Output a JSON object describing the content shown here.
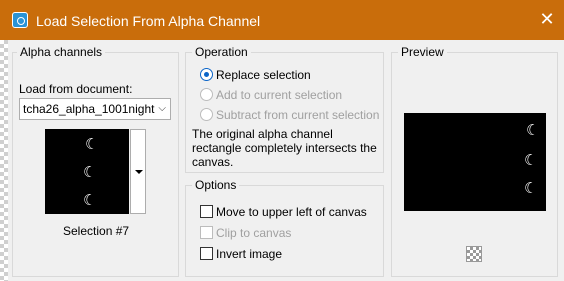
{
  "window": {
    "title": "Load Selection From Alpha Channel",
    "close_glyph": "✕",
    "accent": "#c96d0b",
    "app_icon": "camera-icon"
  },
  "alpha_channels": {
    "group_label": "Alpha channels",
    "load_from_label": "Load from document:",
    "document_value": "tcha26_alpha_1001night",
    "selection_caption": "Selection #7"
  },
  "operation": {
    "group_label": "Operation",
    "options": [
      {
        "label": "Replace selection",
        "checked": true,
        "enabled": true
      },
      {
        "label": "Add to current selection",
        "checked": false,
        "enabled": false
      },
      {
        "label": "Subtract from current selection",
        "checked": false,
        "enabled": false
      }
    ],
    "description": "The original alpha channel rectangle completely intersects the canvas."
  },
  "options": {
    "group_label": "Options",
    "items": [
      {
        "label": "Move to upper left of canvas",
        "checked": false,
        "enabled": true
      },
      {
        "label": "Clip to canvas",
        "checked": false,
        "enabled": false
      },
      {
        "label": "Invert image",
        "checked": false,
        "enabled": true
      }
    ]
  },
  "preview": {
    "group_label": "Preview",
    "zoom_icon": "checkerboard-icon"
  }
}
